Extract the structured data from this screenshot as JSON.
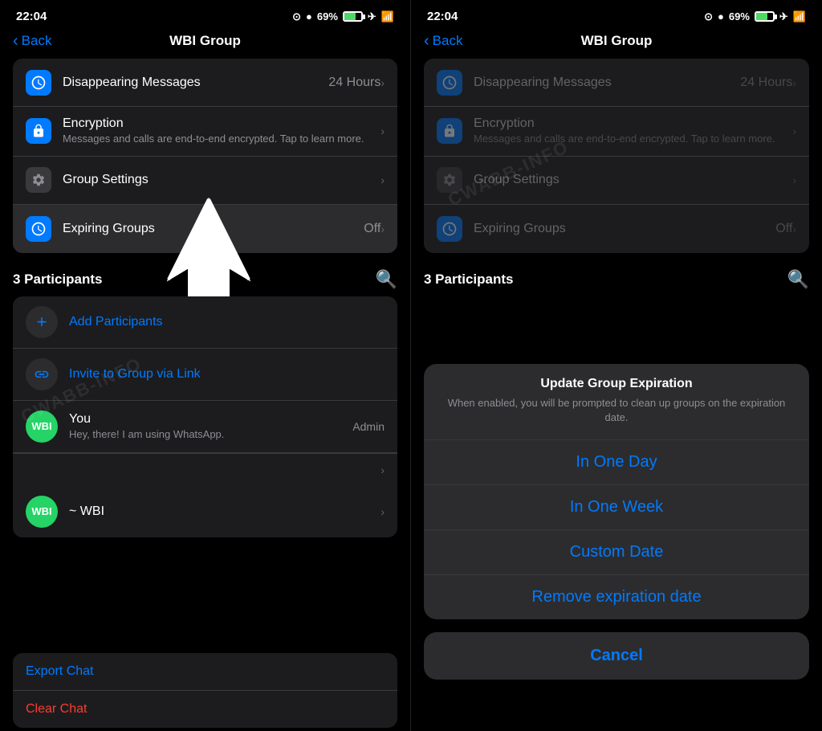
{
  "left_panel": {
    "status": {
      "time": "22:04",
      "battery": "69%",
      "signal": "wifi"
    },
    "header": {
      "back_label": "Back",
      "title": "WBI Group"
    },
    "settings": [
      {
        "icon": "clock-icon",
        "icon_type": "blue",
        "title": "Disappearing Messages",
        "value": "24 Hours",
        "has_chevron": true
      },
      {
        "icon": "lock-icon",
        "icon_type": "blue",
        "title": "Encryption",
        "subtitle": "Messages and calls are end-to-end encrypted. Tap to learn more.",
        "has_chevron": true
      },
      {
        "icon": "gear-icon",
        "icon_type": "dark",
        "title": "Group Settings",
        "has_chevron": true
      },
      {
        "icon": "expiring-icon",
        "icon_type": "blue",
        "title": "Expiring Groups",
        "value": "Off",
        "has_chevron": true,
        "highlighted": true
      }
    ],
    "participants_section": {
      "title": "3 Participants"
    },
    "participants": [
      {
        "type": "add",
        "label": "Add Participants"
      },
      {
        "type": "link",
        "label": "Invite to Group via Link"
      },
      {
        "type": "user",
        "avatar_text": "WBI",
        "name": "You",
        "subtitle": "Hey, there! I am using WhatsApp.",
        "badge": "Admin"
      },
      {
        "type": "more",
        "show_chevron": true
      },
      {
        "type": "user",
        "avatar_text": "WBI",
        "name": "~ WBI",
        "show_chevron": true
      }
    ],
    "bottom_actions": [
      {
        "label": "Export Chat",
        "color": "blue"
      },
      {
        "label": "Clear Chat",
        "color": "red"
      }
    ],
    "watermark": "CWABB-INFO"
  },
  "right_panel": {
    "status": {
      "time": "22:04",
      "battery": "69%"
    },
    "header": {
      "back_label": "Back",
      "title": "WBI Group"
    },
    "settings": [
      {
        "icon": "clock-icon",
        "icon_type": "blue",
        "title": "Disappearing Messages",
        "value": "24 Hours",
        "has_chevron": true,
        "dimmed": true
      },
      {
        "icon": "lock-icon",
        "icon_type": "blue",
        "title": "Encryption",
        "subtitle": "Messages and calls are end-to-end encrypted. Tap to learn more.",
        "has_chevron": true,
        "dimmed": true
      },
      {
        "icon": "gear-icon",
        "icon_type": "dark",
        "title": "Group Settings",
        "has_chevron": true,
        "dimmed": true
      },
      {
        "icon": "expiring-icon",
        "icon_type": "blue",
        "title": "Expiring Groups",
        "value": "Off",
        "has_chevron": true,
        "dimmed": true
      }
    ],
    "participants_section": {
      "title": "3 Participants"
    },
    "modal": {
      "title": "Update Group Expiration",
      "subtitle": "When enabled, you will be prompted to clean up groups on the expiration date.",
      "options": [
        "In One Day",
        "In One Week",
        "Custom Date",
        "Remove expiration date"
      ],
      "cancel": "Cancel"
    },
    "watermark": "CWABB-INFO"
  }
}
